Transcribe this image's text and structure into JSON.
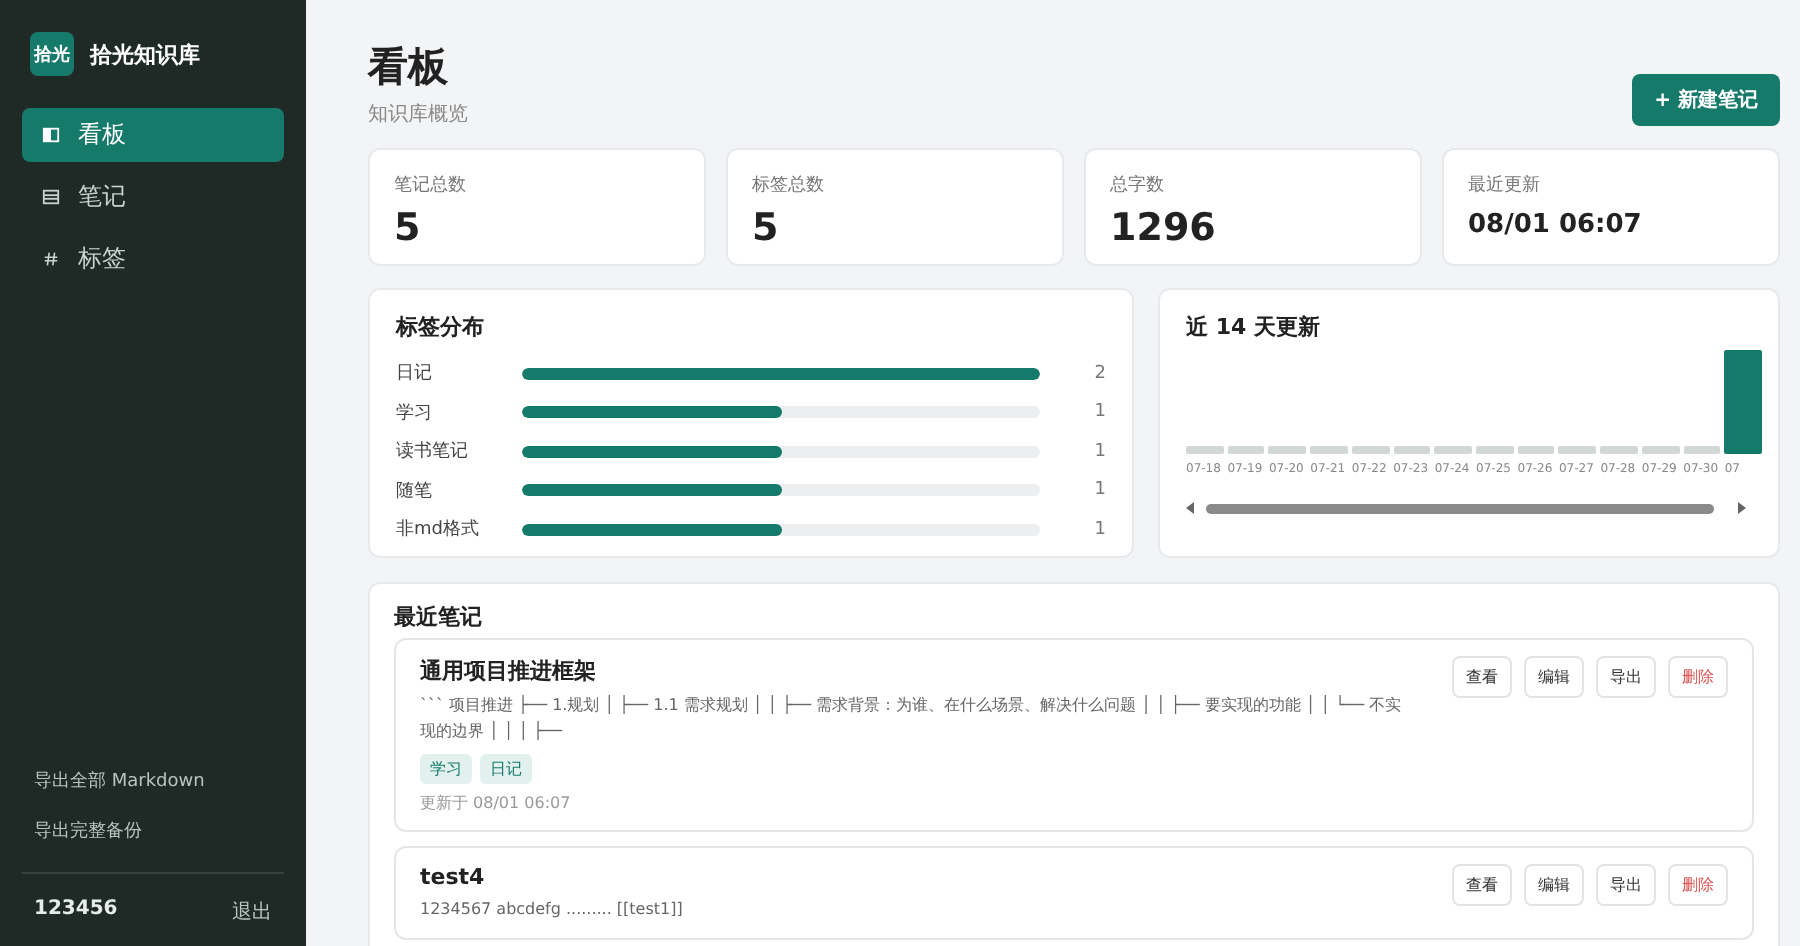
{
  "sidebar": {
    "logo": "拾光",
    "title": "拾光知识库",
    "nav": [
      {
        "label": "看板",
        "selected": true
      },
      {
        "label": "笔记",
        "selected": false
      },
      {
        "label": "标签",
        "selected": false
      }
    ],
    "links": [
      "导出全部 Markdown",
      "导出完整备份"
    ],
    "user": "123456",
    "logout": "退出"
  },
  "header": {
    "title": "看板",
    "subtitle": "知识库概览",
    "new_button": "+ 新建笔记"
  },
  "stats": [
    {
      "label": "笔记总数",
      "value": "5"
    },
    {
      "label": "标签总数",
      "value": "5"
    },
    {
      "label": "总字数",
      "value": "1296"
    },
    {
      "label": "最近更新",
      "value": "08/01 06:07"
    }
  ],
  "tag_distribution": {
    "title": "标签分布",
    "rows": [
      {
        "name": "日记",
        "level": 1,
        "count": "2"
      },
      {
        "name": "学习",
        "level": 0.5,
        "count": "1"
      },
      {
        "name": "读书笔记",
        "level": 0.5,
        "count": "1"
      },
      {
        "name": "随笔",
        "level": 0.5,
        "count": "1"
      },
      {
        "name": "非md格式",
        "level": 0.5,
        "count": "1"
      }
    ]
  },
  "recent_updates": {
    "title": "近 14 天更新",
    "days": [
      {
        "label": "07-18",
        "has_updates": false
      },
      {
        "label": "07-19",
        "has_updates": false
      },
      {
        "label": "07-20",
        "has_updates": false
      },
      {
        "label": "07-21",
        "has_updates": false
      },
      {
        "label": "07-22",
        "has_updates": false
      },
      {
        "label": "07-23",
        "has_updates": false
      },
      {
        "label": "07-24",
        "has_updates": false
      },
      {
        "label": "07-25",
        "has_updates": false
      },
      {
        "label": "07-26",
        "has_updates": false
      },
      {
        "label": "07-27",
        "has_updates": false
      },
      {
        "label": "07-28",
        "has_updates": false
      },
      {
        "label": "07-29",
        "has_updates": false
      },
      {
        "label": "07-30",
        "has_updates": false
      },
      {
        "label": "07",
        "has_updates": true
      }
    ]
  },
  "recent_notes": {
    "title": "最近笔记",
    "notes": [
      {
        "title": "通用项目推进框架",
        "snippet": "``` 项目推进 ├── 1.规划 │ ├── 1.1 需求规划 │ │ ├── 需求背景：为谁、在什么场景、解决什么问题 │ │ ├── 要实现的功能 │ │ └── 不实现的边界 │ │ │ ├──",
        "tags": [
          "学习",
          "日记"
        ],
        "updated": "更新于 08/01 06:07",
        "actions": [
          {
            "kind": "normal",
            "label": "查看"
          },
          {
            "kind": "normal",
            "label": "编辑"
          },
          {
            "kind": "normal",
            "label": "导出"
          },
          {
            "kind": "danger",
            "label": "删除"
          }
        ]
      },
      {
        "title": "test4",
        "snippet": "1234567 abcdefg ......... [[test1]]",
        "actions": [
          {
            "kind": "normal",
            "label": "查看"
          },
          {
            "kind": "normal",
            "label": "编辑"
          },
          {
            "kind": "normal",
            "label": "导出"
          },
          {
            "kind": "danger",
            "label": "删除"
          }
        ]
      }
    ]
  }
}
